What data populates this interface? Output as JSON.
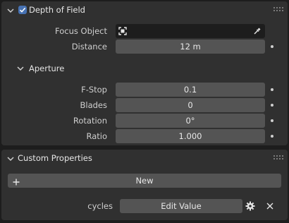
{
  "dof": {
    "title": "Depth of Field",
    "enabled": true,
    "focus_object_label": "Focus Object",
    "distance_label": "Distance",
    "distance_value": "12 m",
    "aperture": {
      "title": "Aperture",
      "fstop_label": "F-Stop",
      "fstop_value": "0.1",
      "blades_label": "Blades",
      "blades_value": "0",
      "rotation_label": "Rotation",
      "rotation_value": "0°",
      "ratio_label": "Ratio",
      "ratio_value": "1.000"
    }
  },
  "custom_properties": {
    "title": "Custom Properties",
    "new_label": "New",
    "property_name": "cycles",
    "edit_label": "Edit Value"
  },
  "colors": {
    "accent": "#4772b3",
    "panel": "#303030",
    "field": "#545454",
    "background": "#1d1d1d"
  },
  "icons": [
    "chevron-down-icon",
    "checkbox-icon",
    "object-icon",
    "eyedropper-icon",
    "drag-grip-icon",
    "plus-icon",
    "gear-icon",
    "close-icon",
    "keyframe-dot-icon"
  ]
}
